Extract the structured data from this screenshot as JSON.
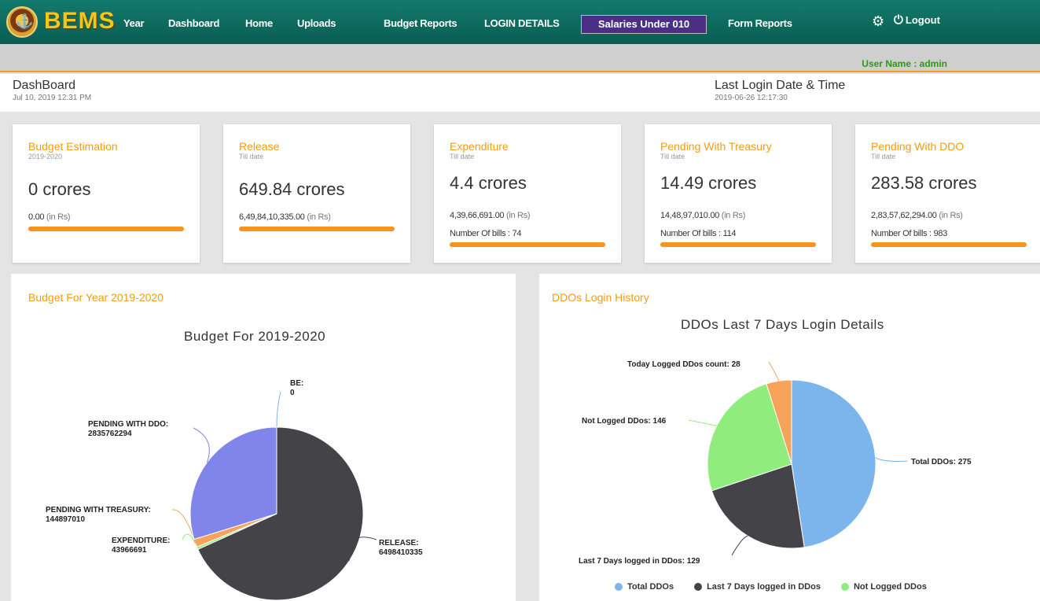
{
  "brand": "BEMS",
  "nav": [
    "Year",
    "Dashboard",
    "Home",
    "Uploads",
    "Budget Reports",
    "LOGIN DETAILS",
    "Salaries Under 010",
    "Form Reports"
  ],
  "logout_label": "Logout",
  "user_label": "User Name : admin",
  "header": {
    "title": "DashBoard",
    "date": "Jul 10, 2019 12:31 PM",
    "last_login_label": "Last Login Date & Time",
    "last_login_value": "2019-06-26 12:17:30"
  },
  "cards": [
    {
      "title": "Budget Estimation",
      "sub": "2019-2020",
      "value": "0 crores",
      "rs": "0.00",
      "unit": "(in Rs)",
      "bills": ""
    },
    {
      "title": "Release",
      "sub": "Till date",
      "value": "649.84 crores",
      "rs": "6,49,84,10,335.00",
      "unit": "(in Rs)",
      "bills": ""
    },
    {
      "title": "Expenditure",
      "sub": "Till date",
      "value": "4.4 crores",
      "rs": "4,39,66,691.00",
      "unit": "(in Rs)",
      "bills": "Number Of bills : 74"
    },
    {
      "title": "Pending With Treasury",
      "sub": "Till date",
      "value": "14.49 crores",
      "rs": "14,48,97,010.00",
      "unit": "(in Rs)",
      "bills": "Number Of bills : 114"
    },
    {
      "title": "Pending With DDO",
      "sub": "Till date",
      "value": "283.58 crores",
      "rs": "2,83,57,62,294.00",
      "unit": "(in Rs)",
      "bills": "Number Of bills : 983"
    }
  ],
  "budget_panel": {
    "title": "Budget For Year 2019-2020",
    "chart_title": "Budget For 2019-2020"
  },
  "ddo_panel": {
    "title": "DDOs Login History",
    "chart_title": "DDOs Last 7 Days Login Details"
  },
  "chart_data": [
    {
      "type": "pie",
      "title": "Budget For 2019-2020",
      "slices": [
        {
          "name": "BE",
          "value": 0,
          "color": "#7cb5ec"
        },
        {
          "name": "RELEASE",
          "value": 6498410335,
          "color": "#434348"
        },
        {
          "name": "EXPENDITURE",
          "value": 43966691,
          "color": "#90ed7d"
        },
        {
          "name": "PENDING WITH TREASURY",
          "value": 144897010,
          "color": "#f7a35c"
        },
        {
          "name": "PENDING WITH DDO",
          "value": 2835762294,
          "color": "#8085e9"
        }
      ]
    },
    {
      "type": "pie",
      "title": "DDOs Last 7 Days Login Details",
      "slices": [
        {
          "name": "Total DDOs",
          "value": 275,
          "color": "#7cb5ec"
        },
        {
          "name": "Last 7 Days logged in DDos",
          "value": 129,
          "color": "#434348"
        },
        {
          "name": "Not Logged DDos",
          "value": 146,
          "color": "#90ed7d"
        },
        {
          "name": "Today Logged DDos count",
          "value": 28,
          "color": "#f7a35c"
        }
      ],
      "legend": [
        "Total DDOs",
        "Last 7 Days logged in DDos",
        "Not Logged DDos"
      ]
    }
  ]
}
